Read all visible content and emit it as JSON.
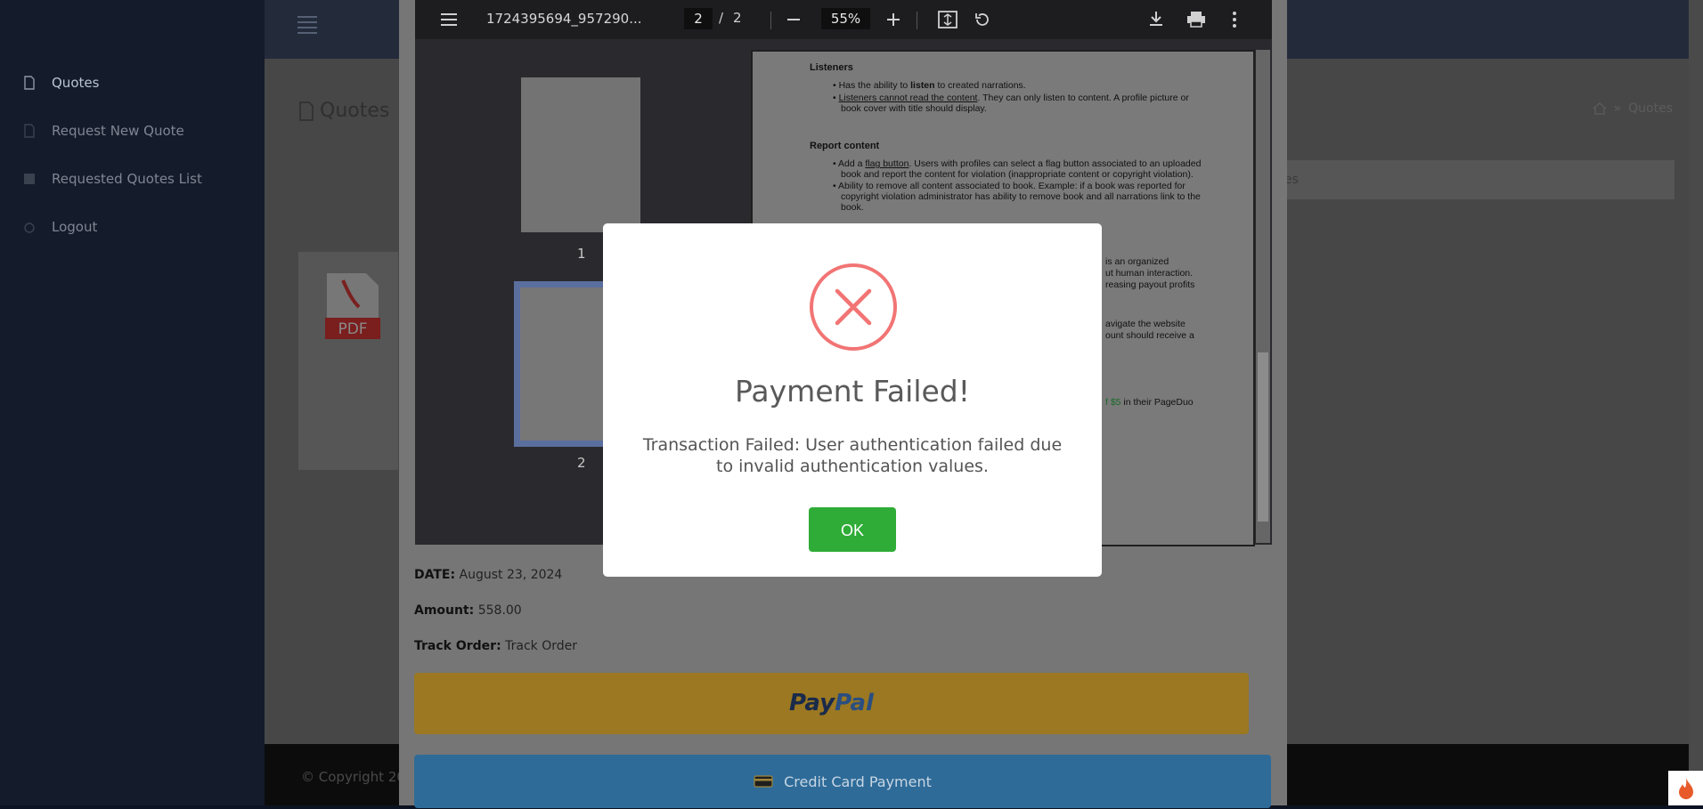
{
  "sidebar": {
    "items": [
      {
        "label": "Quotes"
      },
      {
        "label": "Request New Quote"
      },
      {
        "label": "Requested Quotes List"
      },
      {
        "label": "Logout"
      }
    ]
  },
  "page": {
    "title": "Quotes",
    "breadcrumb": "Quotes",
    "card_tab": "otes",
    "pdf_label": "PDF",
    "footer": "© Copyright 20"
  },
  "pdf_viewer": {
    "filename": "1724395694_957290...",
    "current_page": "2",
    "page_separator": "/",
    "total_pages": "2",
    "zoom": "55%",
    "thumb_labels": [
      "1",
      "2"
    ],
    "doc": {
      "listeners_heading": "Listeners",
      "l1_pre": "Has the ability to ",
      "l1_bold": "listen",
      "l1_post": " to created narrations.",
      "l2_u": "Listeners cannot read the content",
      "l2_post": ". They can only listen to content. A profile picture or",
      "l2b": "book cover with title should display.",
      "report_heading": "Report content",
      "r1_pre": "Add a ",
      "r1_u": "flag button",
      "r1_post": ". Users with profiles can select a flag button associated to an uploaded",
      "r1b": "book and report the content for violation (inappropriate content or copyright violation).",
      "r2": "Ability to remove all content associated to book. Example: if a book was reported for",
      "r2b": "copyright violation administrator has ability to remove book and all narrations link to the",
      "r2c": "book.",
      "p1": "is an organized",
      "p2": "ut human interaction.",
      "p3": "reasing payout profits",
      "p4": "avigate the website",
      "p5": "ount should receive a",
      "p6_green": "f $5",
      "p6_post": " in their PageDuo"
    }
  },
  "order": {
    "date_label": "DATE:",
    "date_value": "August 23, 2024",
    "amount_label": "Amount:",
    "amount_value": "558.00",
    "track_label": "Track Order:",
    "track_value": "Track Order",
    "paypal_pay": "Pay",
    "paypal_pal": "Pal",
    "cc_label": "Credit Card Payment"
  },
  "dialog": {
    "title": "Payment Failed!",
    "message": "Transaction Failed: User authentication failed due to invalid authentication values.",
    "ok": "OK"
  }
}
